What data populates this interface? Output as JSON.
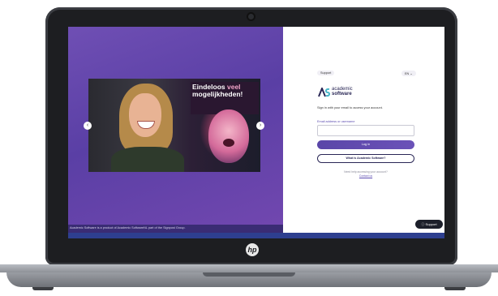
{
  "device": {
    "brand_logo_text": "hp"
  },
  "left_panel": {
    "footer_text": "Academic Software is a product of Academic SoftwareNL part of the Signpost Group.",
    "carousel": {
      "poster_line1": "Eindeloos",
      "poster_line1_accent": "veel",
      "poster_line2": "mogelijkheden!",
      "prev_arrow": "‹",
      "next_arrow": "›"
    }
  },
  "right_panel": {
    "support_pill": "Support",
    "language": "EN ⌄",
    "logo": {
      "line1": "academic",
      "line2": "software",
      "mark": "AS"
    },
    "subtitle": "Sign in with your email to access your account.",
    "email_label": "Email address or username",
    "email_value": "",
    "login_button": "Log in",
    "what_button": "What is Academic Software?",
    "help_text": "Need help accessing your account?",
    "help_link": "Contact us"
  },
  "support_widget": {
    "label": "Support",
    "icon": "help-circle-icon"
  },
  "colors": {
    "primary": "#5a46a8",
    "navy": "#2a2756",
    "left_gradient": "#6f4fb4"
  }
}
